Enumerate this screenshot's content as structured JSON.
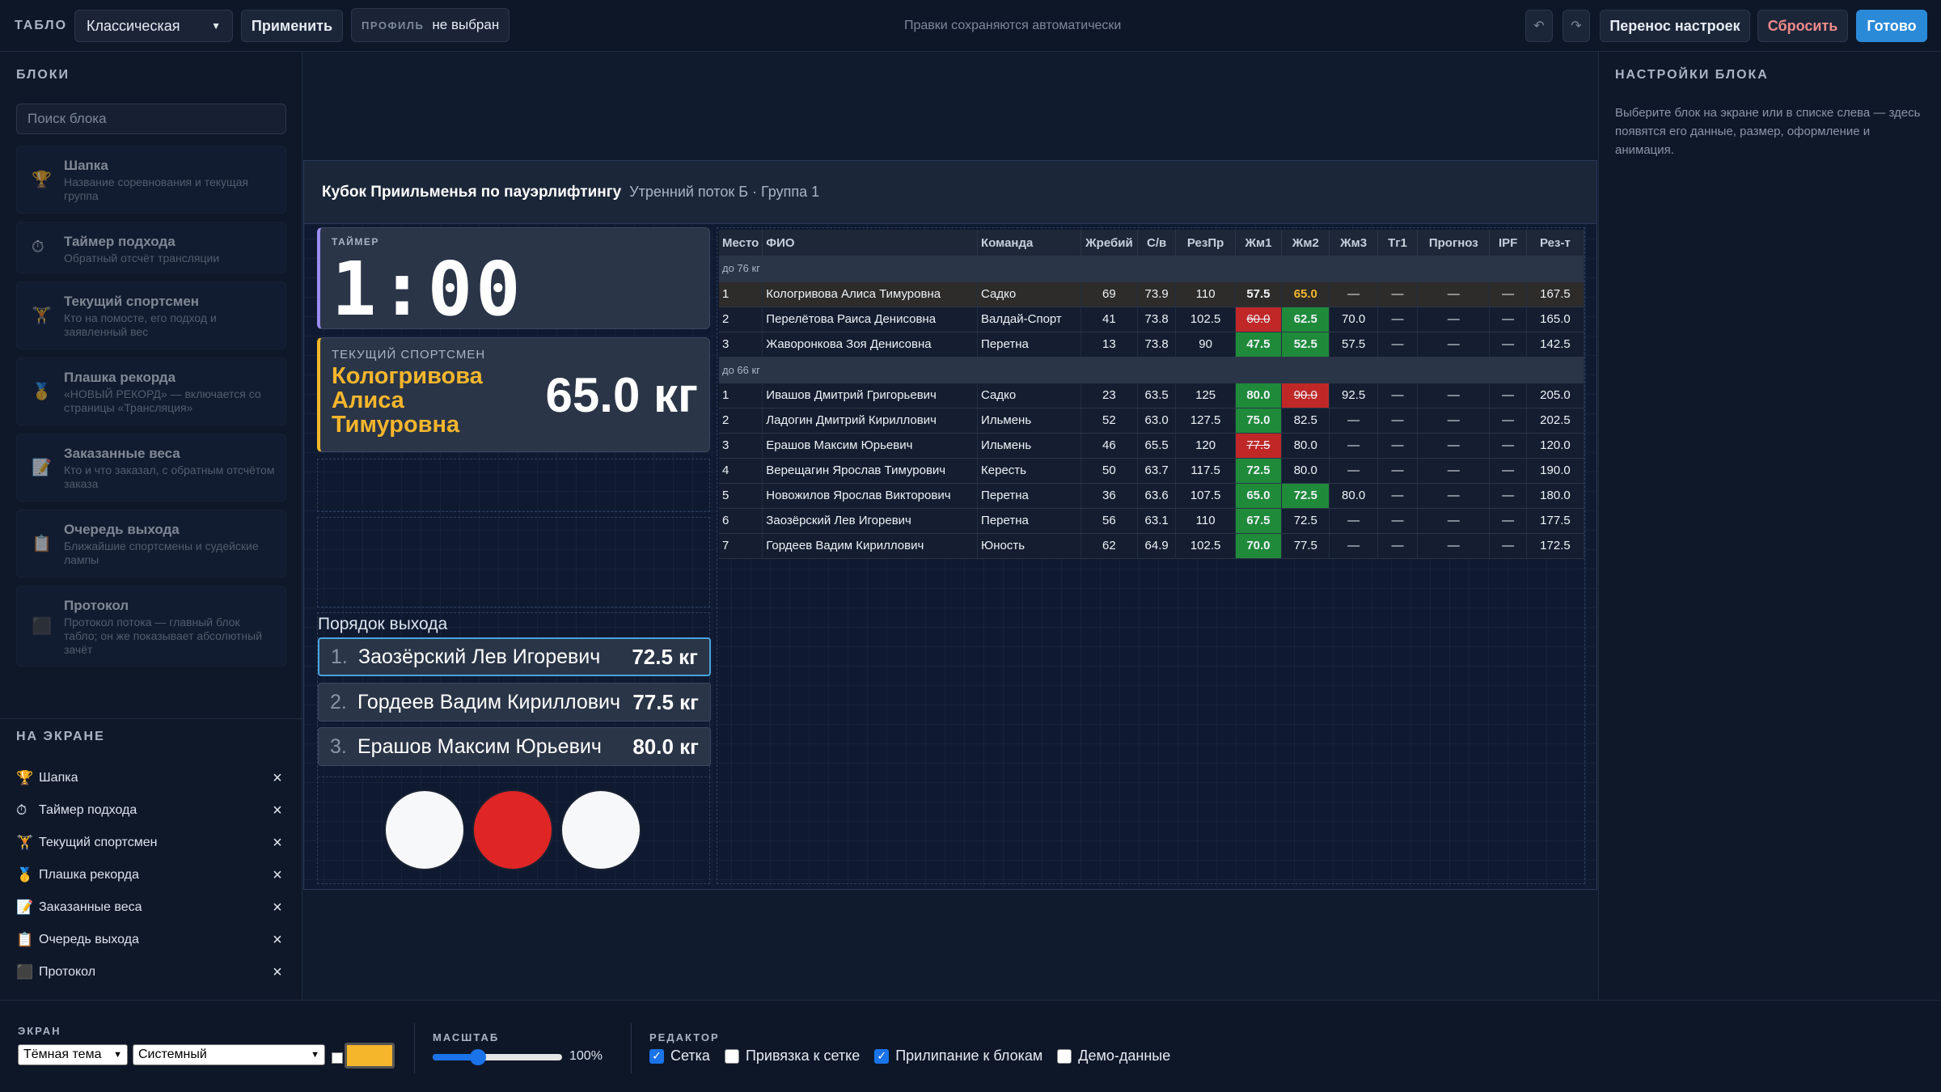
{
  "topbar": {
    "label": "ТАБЛО",
    "layout_select": "Классическая",
    "apply": "Применить",
    "profile_key": "ПРОФИЛЬ",
    "profile_value": "не выбран",
    "autosave": "Правки сохраняются автоматически",
    "transfer": "Перенос настроек",
    "reset": "Сбросить",
    "done": "Готово"
  },
  "left": {
    "blocks_title": "БЛОКИ",
    "search_placeholder": "Поиск блока",
    "blocks": [
      {
        "icon": "🏆",
        "title": "Шапка",
        "desc": "Название соревнования и текущая группа"
      },
      {
        "icon": "⏱",
        "title": "Таймер подхода",
        "desc": "Обратный отсчёт трансляции"
      },
      {
        "icon": "🏋",
        "title": "Текущий спортсмен",
        "desc": "Кто на помосте, его подход и заявленный вес"
      },
      {
        "icon": "🥇",
        "title": "Плашка рекорда",
        "desc": "«НОВЫЙ РЕКОРД» — включается со страницы «Трансляция»"
      },
      {
        "icon": "📝",
        "title": "Заказанные веса",
        "desc": "Кто и что заказал, с обратным отсчётом заказа"
      },
      {
        "icon": "📋",
        "title": "Очередь выхода",
        "desc": "Ближайшие спортсмены и судейские лампы"
      },
      {
        "icon": "⬛",
        "title": "Протокол",
        "desc": "Протокол потока — главный блок табло; он же показывает абсолютный зачёт"
      }
    ],
    "on_screen_title": "НА ЭКРАНЕ",
    "on_screen": [
      {
        "icon": "🏆",
        "title": "Шапка"
      },
      {
        "icon": "⏱",
        "title": "Таймер подхода"
      },
      {
        "icon": "🏋",
        "title": "Текущий спортсмен"
      },
      {
        "icon": "🥇",
        "title": "Плашка рекорда"
      },
      {
        "icon": "📝",
        "title": "Заказанные веса"
      },
      {
        "icon": "📋",
        "title": "Очередь выхода"
      },
      {
        "icon": "⬛",
        "title": "Протокол"
      }
    ],
    "remove_glyph": "×"
  },
  "right": {
    "title": "НАСТРОЙКИ БЛОКА",
    "hint": "Выберите блок на экране или в списке слева — здесь появятся его данные, размер, оформление и анимация."
  },
  "screen": {
    "header_title": "Кубок Приильменья по пауэрлифтингу",
    "header_sub": "Утренний поток Б · Группа 1",
    "timer_label": "ТАЙМЕР",
    "timer": "1:00",
    "current_label": "ТЕКУЩИЙ СПОРТСМЕН",
    "current_name": "Кологривова Алиса Тимуровна",
    "current_weight": "65.0 кг",
    "queue_title": "Порядок выхода",
    "queue": [
      {
        "n": "1.",
        "name": "Заозёрский Лев Игоревич",
        "w": "72.5 кг"
      },
      {
        "n": "2.",
        "name": "Гордеев Вадим Кириллович",
        "w": "77.5 кг"
      },
      {
        "n": "3.",
        "name": "Ерашов Максим Юрьевич",
        "w": "80.0 кг"
      }
    ],
    "lamps": [
      {
        "color": "#f7f8fa"
      },
      {
        "color": "#e02525"
      },
      {
        "color": "#f7f8fa"
      }
    ]
  },
  "protocol": {
    "columns": [
      "Место",
      "ФИО",
      "Команда",
      "Жребий",
      "С/в",
      "РезПр",
      "Жм1",
      "Жм2",
      "Жм3",
      "Тг1",
      "Прогноз",
      "IPF",
      "Рез-т"
    ],
    "groups": [
      {
        "name": "до 76 кг",
        "rows": [
          {
            "place": "1",
            "name": "Кологривова Алиса Тимуровна",
            "team": "Садко",
            "lot": "69",
            "bw": "73.9",
            "rp": "110",
            "a1": {
              "v": "57.5",
              "s": "good"
            },
            "a2": {
              "v": "65.0",
              "s": "pend"
            },
            "a3": {
              "v": "—",
              "s": ""
            },
            "t1": "—",
            "fc": "—",
            "ipf": "—",
            "res": "167.5",
            "hl": true
          },
          {
            "place": "2",
            "name": "Перелётова Раиса Денисовна",
            "team": "Валдай-Спорт",
            "lot": "41",
            "bw": "73.8",
            "rp": "102.5",
            "a1": {
              "v": "60.0",
              "s": "bad"
            },
            "a2": {
              "v": "62.5",
              "s": "good"
            },
            "a3": {
              "v": "70.0",
              "s": ""
            },
            "t1": "—",
            "fc": "—",
            "ipf": "—",
            "res": "165.0"
          },
          {
            "place": "3",
            "name": "Жаворонкова Зоя Денисовна",
            "team": "Перетна",
            "lot": "13",
            "bw": "73.8",
            "rp": "90",
            "a1": {
              "v": "47.5",
              "s": "good"
            },
            "a2": {
              "v": "52.5",
              "s": "good"
            },
            "a3": {
              "v": "57.5",
              "s": ""
            },
            "t1": "—",
            "fc": "—",
            "ipf": "—",
            "res": "142.5"
          }
        ]
      },
      {
        "name": "до 66 кг",
        "rows": [
          {
            "place": "1",
            "name": "Ивашов Дмитрий Григорьевич",
            "team": "Садко",
            "lot": "23",
            "bw": "63.5",
            "rp": "125",
            "a1": {
              "v": "80.0",
              "s": "good"
            },
            "a2": {
              "v": "90.0",
              "s": "bad"
            },
            "a3": {
              "v": "92.5",
              "s": ""
            },
            "t1": "—",
            "fc": "—",
            "ipf": "—",
            "res": "205.0"
          },
          {
            "place": "2",
            "name": "Ладогин Дмитрий Кириллович",
            "team": "Ильмень",
            "lot": "52",
            "bw": "63.0",
            "rp": "127.5",
            "a1": {
              "v": "75.0",
              "s": "good"
            },
            "a2": {
              "v": "82.5",
              "s": ""
            },
            "a3": {
              "v": "—",
              "s": ""
            },
            "t1": "—",
            "fc": "—",
            "ipf": "—",
            "res": "202.5"
          },
          {
            "place": "3",
            "name": "Ерашов Максим Юрьевич",
            "team": "Ильмень",
            "lot": "46",
            "bw": "65.5",
            "rp": "120",
            "a1": {
              "v": "77.5",
              "s": "bad"
            },
            "a2": {
              "v": "80.0",
              "s": ""
            },
            "a3": {
              "v": "—",
              "s": ""
            },
            "t1": "—",
            "fc": "—",
            "ipf": "—",
            "res": "120.0"
          },
          {
            "place": "4",
            "name": "Верещагин Ярослав Тимурович",
            "team": "Кересть",
            "lot": "50",
            "bw": "63.7",
            "rp": "117.5",
            "a1": {
              "v": "72.5",
              "s": "good"
            },
            "a2": {
              "v": "80.0",
              "s": ""
            },
            "a3": {
              "v": "—",
              "s": ""
            },
            "t1": "—",
            "fc": "—",
            "ipf": "—",
            "res": "190.0"
          },
          {
            "place": "5",
            "name": "Новожилов Ярослав Викторович",
            "team": "Перетна",
            "lot": "36",
            "bw": "63.6",
            "rp": "107.5",
            "a1": {
              "v": "65.0",
              "s": "good"
            },
            "a2": {
              "v": "72.5",
              "s": "good"
            },
            "a3": {
              "v": "80.0",
              "s": ""
            },
            "t1": "—",
            "fc": "—",
            "ipf": "—",
            "res": "180.0"
          },
          {
            "place": "6",
            "name": "Заозёрский Лев Игоревич",
            "team": "Перетна",
            "lot": "56",
            "bw": "63.1",
            "rp": "110",
            "a1": {
              "v": "67.5",
              "s": "good"
            },
            "a2": {
              "v": "72.5",
              "s": ""
            },
            "a3": {
              "v": "—",
              "s": ""
            },
            "t1": "—",
            "fc": "—",
            "ipf": "—",
            "res": "177.5"
          },
          {
            "place": "7",
            "name": "Гордеев Вадим Кириллович",
            "team": "Юность",
            "lot": "62",
            "bw": "64.9",
            "rp": "102.5",
            "a1": {
              "v": "70.0",
              "s": "good"
            },
            "a2": {
              "v": "77.5",
              "s": ""
            },
            "a3": {
              "v": "—",
              "s": ""
            },
            "t1": "—",
            "fc": "—",
            "ipf": "—",
            "res": "172.5"
          }
        ]
      }
    ]
  },
  "bottom": {
    "screen_label": "ЭКРАН",
    "theme": "Тёмная тема",
    "font": "Системный",
    "accent_color": "#f5b62c",
    "scale_label": "МАСШТАБ",
    "scale_value": "100%",
    "scale_level": 0.35,
    "editor_label": "РЕДАКТОР",
    "options": [
      {
        "label": "Сетка",
        "on": true
      },
      {
        "label": "Привязка к сетке",
        "on": false
      },
      {
        "label": "Прилипание к блокам",
        "on": true
      },
      {
        "label": "Демо-данные",
        "on": false
      }
    ]
  }
}
